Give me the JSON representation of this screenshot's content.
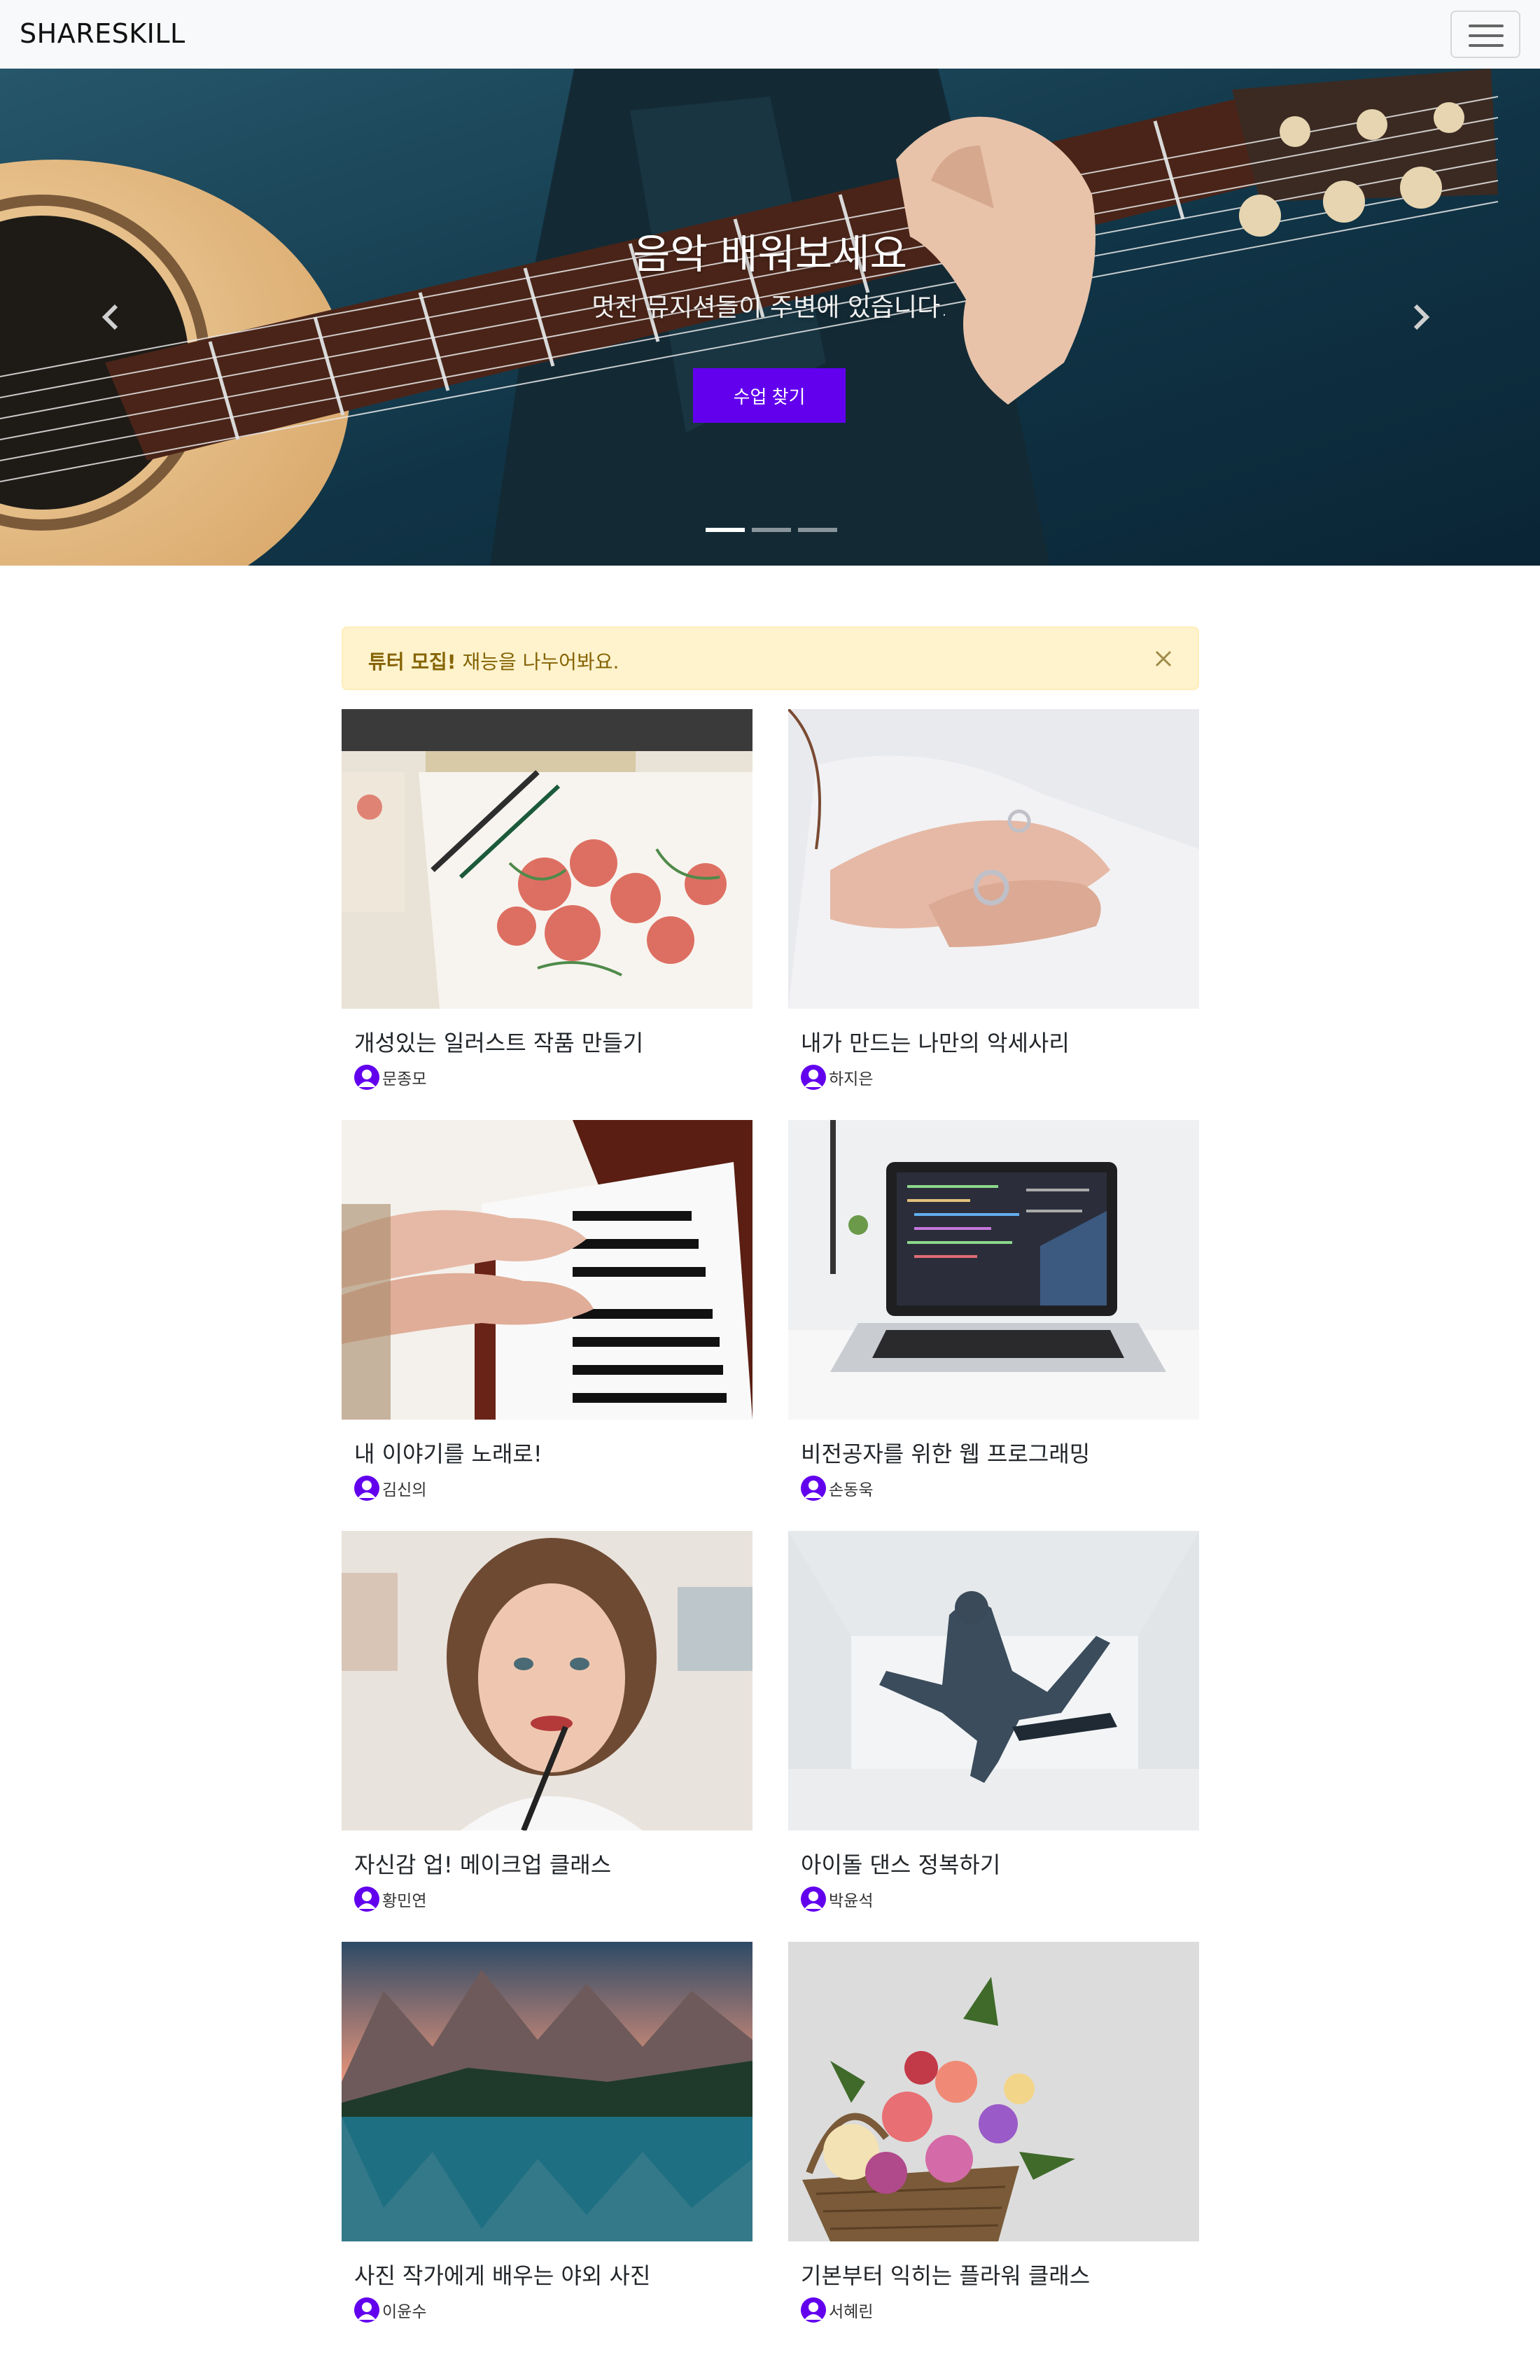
{
  "navbar": {
    "brand": "SHARESKILL",
    "toggler_icon": "hamburger-icon"
  },
  "hero": {
    "title": "음악 배워보세요",
    "subtitle": "멋진 뮤지션들이 주변에 있습니다.",
    "button_label": "수업 찾기",
    "prev_icon": "chevron-left-icon",
    "next_icon": "chevron-right-icon",
    "slides": 3,
    "active_slide": 1
  },
  "alert": {
    "strong": "튜터 모집!",
    "text": "재능을 나누어봐요.",
    "close_icon": "close-icon"
  },
  "courses": [
    {
      "title": "개성있는 일러스트 작품 만들기",
      "author": "문종모",
      "image": "watercolor-flowers"
    },
    {
      "title": "내가 만드는 나만의 악세사리",
      "author": "하지은",
      "image": "hands-rings"
    },
    {
      "title": "내 이야기를 노래로!",
      "author": "김신의",
      "image": "piano-hands"
    },
    {
      "title": "비전공자를 위한 웹 프로그래밍",
      "author": "손동욱",
      "image": "laptop-code"
    },
    {
      "title": "자신감 업! 메이크업 클래스",
      "author": "황민연",
      "image": "woman-lipstick"
    },
    {
      "title": "아이돌 댄스 정복하기",
      "author": "박윤석",
      "image": "dancer-jump"
    },
    {
      "title": "사진 작가에게 배우는 야외 사진",
      "author": "이윤수",
      "image": "mountain-lake"
    },
    {
      "title": "기본부터 익히는 플라워 클래스",
      "author": "서혜린",
      "image": "flower-basket"
    }
  ],
  "colors": {
    "accent": "#6200ee",
    "alert_bg": "#fff3cd",
    "alert_text": "#856404",
    "navbar_bg": "#f8f9fa"
  }
}
